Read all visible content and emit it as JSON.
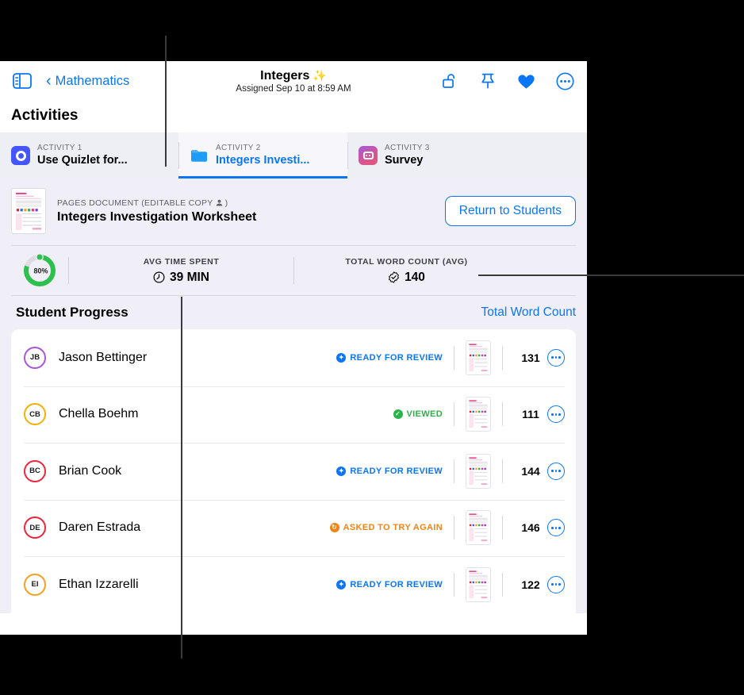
{
  "toolbar": {
    "sidebar_icon": "sidebar-icon",
    "back_label": "Mathematics",
    "back_chevron": "‹",
    "title": "Integers",
    "title_sparkle": "✨",
    "subtitle": "Assigned Sep 10 at 8:59 AM",
    "icons": [
      {
        "name": "unlock-icon",
        "label": "Unlock"
      },
      {
        "name": "pin-icon",
        "label": "Pin"
      },
      {
        "name": "heart-icon",
        "label": "Favorite"
      },
      {
        "name": "more-circle-icon",
        "label": "More"
      }
    ],
    "accent": "#0a76f6"
  },
  "page": {
    "section_heading": "Activities"
  },
  "tabs": [
    {
      "kicker": "ACTIVITY 1",
      "name": "Use Quizlet for...",
      "icon": "quizlet-icon",
      "active": false
    },
    {
      "kicker": "ACTIVITY 2",
      "name": "Integers Investi...",
      "icon": "folder-icon",
      "active": true
    },
    {
      "kicker": "ACTIVITY 3",
      "name": "Survey",
      "icon": "survey-icon",
      "active": false
    }
  ],
  "document": {
    "kicker": "PAGES DOCUMENT (EDITABLE COPY",
    "kicker_person_icon": "person-icon",
    "kicker_close": ")",
    "name": "Integers Investigation Worksheet",
    "thumbnail": "document-thumbnail",
    "return_button": "Return to Students"
  },
  "stats": {
    "ring": {
      "percent_label": "80%",
      "percent_value": 80,
      "color": "#2ec04c",
      "track": "#dcdce2"
    },
    "cells": [
      {
        "label": "AVG TIME SPENT",
        "value": "39 MIN",
        "icon": "clock-icon"
      },
      {
        "label": "TOTAL WORD COUNT (AVG)",
        "value": "140",
        "icon": "badge-check-icon"
      }
    ]
  },
  "student_progress": {
    "title": "Student Progress",
    "link": "Total Word Count",
    "rows": [
      {
        "initials": "JB",
        "name": "Jason Bettinger",
        "ring": "#a855d8",
        "status": "READY FOR REVIEW",
        "status_color": "#0a76f6",
        "status_icon": "star-badge-icon",
        "word_count": "131",
        "thumbnail": "submission-thumbnail"
      },
      {
        "initials": "CB",
        "name": "Chella Boehm",
        "ring": "#f0b400",
        "status": "VIEWED",
        "status_color": "#28b446",
        "status_icon": "check-badge-icon",
        "word_count": "111",
        "thumbnail": "submission-thumbnail"
      },
      {
        "initials": "BC",
        "name": "Brian Cook",
        "ring": "#f0243c",
        "status": "READY FOR REVIEW",
        "status_color": "#0a76f6",
        "status_icon": "star-badge-icon",
        "word_count": "144",
        "thumbnail": "submission-thumbnail"
      },
      {
        "initials": "DE",
        "name": "Daren Estrada",
        "ring": "#f0243c",
        "status": "ASKED TO TRY AGAIN",
        "status_color": "#f28416",
        "status_icon": "refresh-badge-icon",
        "word_count": "146",
        "thumbnail": "submission-thumbnail"
      },
      {
        "initials": "EI",
        "name": "Ethan Izzarelli",
        "ring": "#f5a01e",
        "status": "READY FOR REVIEW",
        "status_color": "#0a76f6",
        "status_icon": "star-badge-icon",
        "word_count": "122",
        "thumbnail": "submission-thumbnail"
      }
    ]
  }
}
